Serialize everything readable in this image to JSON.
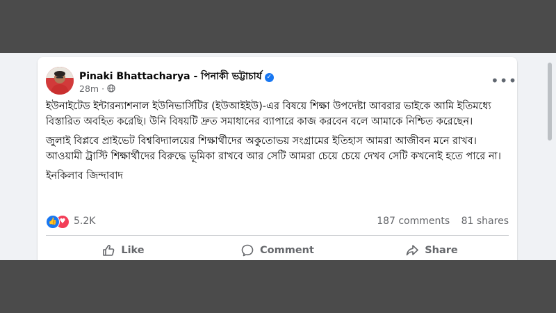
{
  "post": {
    "author": "Pinaki Bhattacharya - পিনাকী ভট্টাচার্য",
    "time": "28m",
    "verified_icon": "verified-badge-icon",
    "privacy_icon": "globe-icon",
    "paragraphs": [
      "ইউনাইটেড ইন্টারন্যাশনাল ইউনিভার্সিটির (ইউআইইউ)-এর বিষয়ে শিক্ষা উপদেষ্টা আবরার ভাইকে আমি ইতিমধ্যে বিস্তারিত অবহিত করেছি। উনি বিষয়টি দ্রুত সমাধানের ব্যাপারে কাজ করবেন বলে আমাকে নিশ্চিত করেছেন।",
      "জুলাই বিপ্লবে প্রাইভেট বিশ্ববিদ্যালয়ের শিক্ষার্থীদের অকুতোভয় সংগ্রামের ইতিহাস আমরা আজীবন মনে রাখব। আওয়ামী ট্রাস্টি শিক্ষার্থীদের বিরুদ্ধে ভূমিকা রাখবে আর সেটি আমরা চেয়ে চেয়ে দেখব সেটি কখনোই হতে পারে না।",
      "ইনকিলাব জিন্দাবাদ"
    ],
    "reaction_count": "5.2K",
    "comments": "187 comments",
    "shares": "81 shares"
  },
  "actions": {
    "like": "Like",
    "comment": "Comment",
    "share": "Share"
  },
  "colors": {
    "accent": "#1877f2",
    "love": "#f33e58",
    "muted_text": "#65676b",
    "background": "#f0f2f5"
  }
}
